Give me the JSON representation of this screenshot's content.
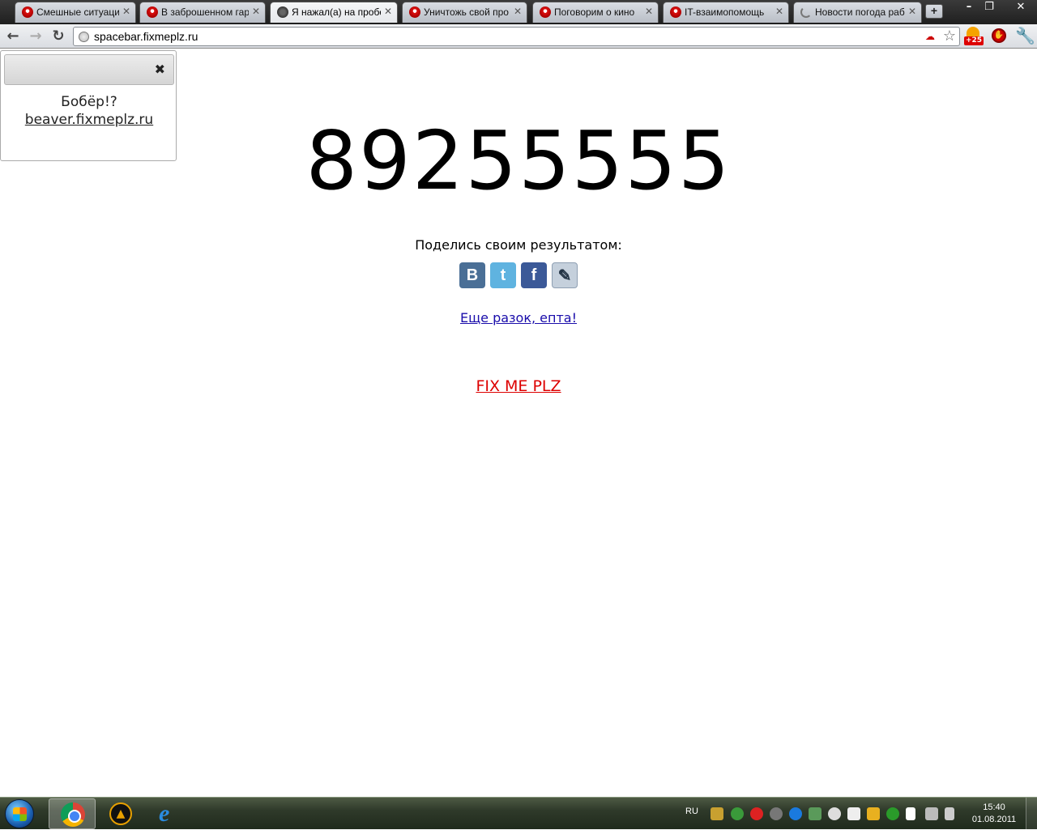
{
  "browser": {
    "tabs": [
      {
        "title": "Смешные ситуации",
        "icon": "red-favicon",
        "active": false
      },
      {
        "title": "В заброшенном гар",
        "icon": "red-favicon",
        "active": false
      },
      {
        "title": "Я нажал(а) на пробе",
        "icon": "globe-favicon",
        "active": true
      },
      {
        "title": "Уничтожь свой про",
        "icon": "red-favicon",
        "active": false
      },
      {
        "title": "Поговорим о кино",
        "icon": "red-favicon",
        "active": false
      },
      {
        "title": "IT-взаимопомощь",
        "icon": "red-favicon",
        "active": false
      },
      {
        "title": "Новости погода раб",
        "icon": "loading-spinner",
        "active": false
      }
    ],
    "new_tab_label": "+",
    "window_controls": {
      "minimize": "–",
      "restore": "❐",
      "close": "✕"
    },
    "nav": {
      "back": "←",
      "forward": "→",
      "reload": "↻"
    },
    "address": "spacebar.fixmeplz.ru",
    "extensions": {
      "weather_badge": "+25"
    }
  },
  "popup": {
    "close_label": "✖",
    "question": "Бобёр!?",
    "link": "beaver.fixmeplz.ru"
  },
  "page": {
    "score": "89255555",
    "share_label": "Поделись своим результатом:",
    "share_buttons": [
      {
        "name": "vkontakte",
        "glyph": "B",
        "color": "#4a6f96"
      },
      {
        "name": "twitter",
        "glyph": "t",
        "color": "#5fb3e0"
      },
      {
        "name": "facebook",
        "glyph": "f",
        "color": "#3b5998"
      },
      {
        "name": "livejournal",
        "glyph": "✎",
        "color": "#c5d0dc"
      }
    ],
    "again_link": "Еще разок, епта!",
    "fixme_link": "FIX ME PLZ"
  },
  "taskbar": {
    "apps": [
      "chrome",
      "aimp",
      "internet-explorer"
    ],
    "language": "RU",
    "time": "15:40",
    "date": "01.08.2011"
  }
}
